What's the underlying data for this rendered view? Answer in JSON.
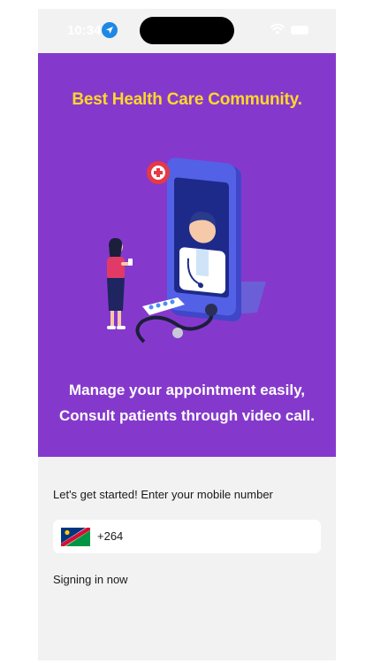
{
  "status_bar": {
    "time": "10:34",
    "location_icon": "location-arrow-icon",
    "wifi_icon": "wifi-icon",
    "battery_icon": "battery-icon"
  },
  "hero": {
    "title": "Best Health Care Community.",
    "illustration": "doctor-video-call-illustration",
    "tagline_line1": "Manage your appointment easily,",
    "tagline_line2": "Consult patients through video call.",
    "background_color": "#8539cc",
    "title_color": "#ffd829"
  },
  "login": {
    "prompt": "Let's get started! Enter your mobile number",
    "country_flag": "namibia-flag-icon",
    "dial_code": "+264",
    "status": "Signing in now"
  }
}
